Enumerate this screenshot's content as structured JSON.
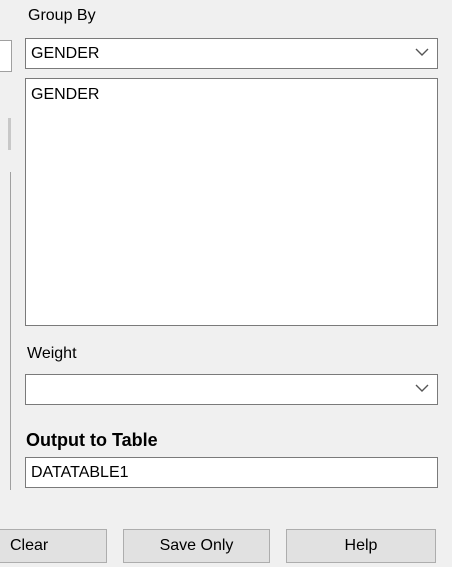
{
  "group_by": {
    "label": "Group By",
    "selected": "GENDER",
    "list_items": [
      "GENDER"
    ]
  },
  "weight": {
    "label": "Weight",
    "selected": ""
  },
  "output": {
    "label": "Output to Table",
    "value": "DATATABLE1"
  },
  "buttons": {
    "clear": "Clear",
    "save_only": "Save Only",
    "help": "Help"
  },
  "icons": {
    "dropdown": "chevron-down-icon"
  }
}
